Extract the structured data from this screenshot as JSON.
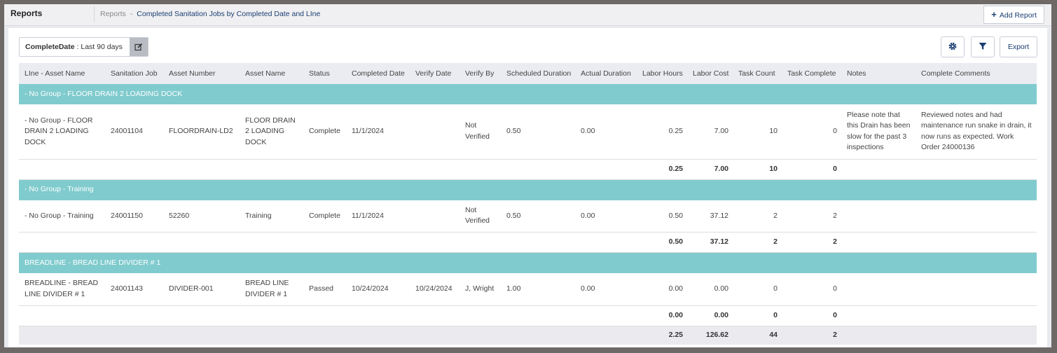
{
  "header": {
    "title": "Reports",
    "breadcrumb_root": "Reports",
    "breadcrumb_sep": "-",
    "breadcrumb_current": "Completed Sanitation Jobs by Completed Date and LIne",
    "add_report_icon": "+",
    "add_report_label": "Add Report"
  },
  "filter": {
    "field": "CompleteDate",
    "value": ": Last 90 days",
    "edit_icon": "edit-icon"
  },
  "toolbar": {
    "settings_icon": "gear-icon",
    "filter_icon": "funnel-icon",
    "export_label": "Export"
  },
  "columns": [
    "LIne - Asset Name",
    "Sanitation Job",
    "Asset Number",
    "Asset Name",
    "Status",
    "Completed Date",
    "Verify Date",
    "Verify By",
    "Scheduled Duration",
    "Actual Duration",
    "Labor Hours",
    "Labor Cost",
    "Task Count",
    "Task Complete",
    "Notes",
    "Complete Comments"
  ],
  "groups": [
    {
      "name": "- No Group - FLOOR DRAIN 2 LOADING DOCK",
      "rows": [
        {
          "line_asset": "- No Group - FLOOR DRAIN 2 LOADING DOCK",
          "job": "24001104",
          "asset_number": "FLOORDRAIN-LD2",
          "asset_name": "FLOOR DRAIN 2 LOADING DOCK",
          "status": "Complete",
          "completed_date": "11/1/2024",
          "verify_date": "",
          "verify_by": "Not Verified",
          "scheduled": "0.50",
          "actual": "0.00",
          "labor_hours": "0.25",
          "labor_cost": "7.00",
          "task_count": "10",
          "task_complete": "0",
          "notes": "Please note that this Drain has been slow for the past 3 inspections",
          "comments": "Reviewed notes and had maintenance run snake in drain, it now runs as expected. Work Order 24000136"
        }
      ],
      "subtotal": {
        "labor_hours": "0.25",
        "labor_cost": "7.00",
        "task_count": "10",
        "task_complete": "0"
      }
    },
    {
      "name": "- No Group - Training",
      "rows": [
        {
          "line_asset": "- No Group - Training",
          "job": "24001150",
          "asset_number": "52260",
          "asset_name": "Training",
          "status": "Complete",
          "completed_date": "11/1/2024",
          "verify_date": "",
          "verify_by": "Not Verified",
          "scheduled": "0.50",
          "actual": "0.00",
          "labor_hours": "0.50",
          "labor_cost": "37.12",
          "task_count": "2",
          "task_complete": "2",
          "notes": "",
          "comments": ""
        }
      ],
      "subtotal": {
        "labor_hours": "0.50",
        "labor_cost": "37.12",
        "task_count": "2",
        "task_complete": "2"
      }
    },
    {
      "name": "BREADLINE - BREAD LINE DIVIDER # 1",
      "rows": [
        {
          "line_asset": "BREADLINE - BREAD LINE DIVIDER # 1",
          "job": "24001143",
          "asset_number": "DIVIDER-001",
          "asset_name": "BREAD LINE DIVIDER # 1",
          "status": "Passed",
          "completed_date": "10/24/2024",
          "verify_date": "10/24/2024",
          "verify_by": "J, Wright",
          "scheduled": "1.00",
          "actual": "0.00",
          "labor_hours": "0.00",
          "labor_cost": "0.00",
          "task_count": "0",
          "task_complete": "0",
          "notes": "",
          "comments": ""
        }
      ],
      "subtotal": {
        "labor_hours": "0.00",
        "labor_cost": "0.00",
        "task_count": "0",
        "task_complete": "0"
      }
    }
  ],
  "grand_total": {
    "labor_hours": "2.25",
    "labor_cost": "126.62",
    "task_count": "44",
    "task_complete": "2"
  },
  "colors": {
    "group_row": "#80cbce",
    "link": "#1a3e72",
    "header_bg": "#ebebf2"
  }
}
